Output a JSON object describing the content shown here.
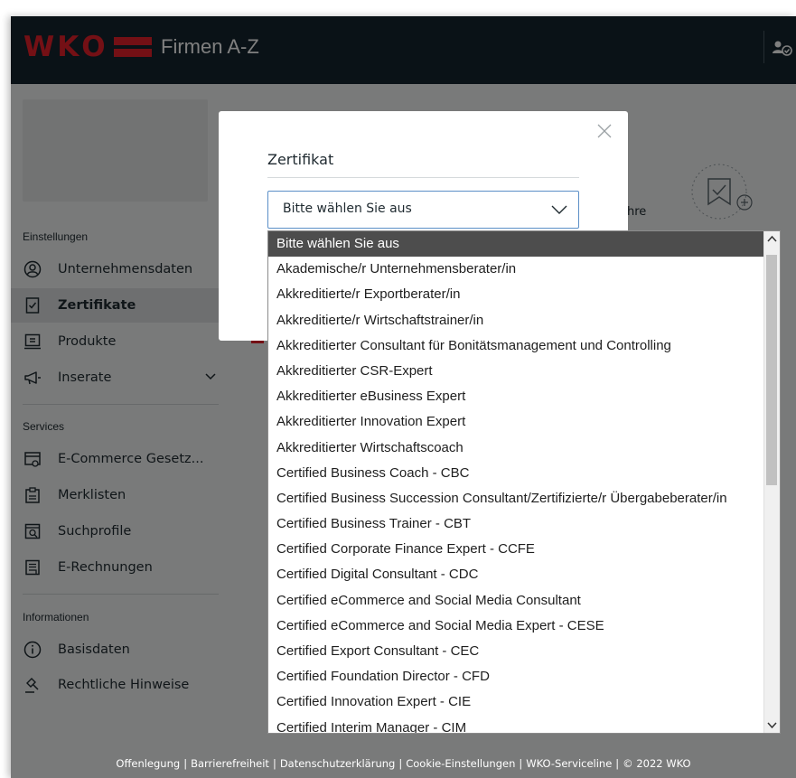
{
  "header": {
    "logo_letters": [
      "W",
      "K",
      "O"
    ],
    "app_title": "Firmen A-Z"
  },
  "sidebar": {
    "sections": [
      {
        "title": "Einstellungen",
        "items": [
          {
            "label": "Unternehmensdaten",
            "icon": "user-circle-icon"
          },
          {
            "label": "Zertifikate",
            "icon": "certificate-icon",
            "active": true
          },
          {
            "label": "Produkte",
            "icon": "product-icon"
          },
          {
            "label": "Inserate",
            "icon": "megaphone-icon",
            "has_chevron": true
          }
        ]
      },
      {
        "title": "Services",
        "items": [
          {
            "label": "E-Commerce Gesetz...",
            "icon": "ecommerce-icon"
          },
          {
            "label": "Merklisten",
            "icon": "clipboard-icon"
          },
          {
            "label": "Suchprofile",
            "icon": "search-profile-icon"
          },
          {
            "label": "E-Rechnungen",
            "icon": "invoice-icon"
          }
        ]
      },
      {
        "title": "Informationen",
        "items": [
          {
            "label": "Basisdaten",
            "icon": "info-icon"
          },
          {
            "label": "Rechtliche Hinweise",
            "icon": "gavel-icon"
          }
        ]
      }
    ]
  },
  "content": {
    "partial_text": "hre"
  },
  "modal": {
    "title": "Zertifikat",
    "select_value": "Bitte wählen Sie aus"
  },
  "dropdown": {
    "options": [
      "Bitte wählen Sie aus",
      "Akademische/r Unternehmensberater/in",
      "Akkreditierte/r Exportberater/in",
      "Akkreditierte/r Wirtschaftstrainer/in",
      "Akkreditierter Consultant für Bonitätsmanagement und Controlling",
      "Akkreditierter CSR-Expert",
      "Akkreditierter eBusiness Expert",
      "Akkreditierter Innovation Expert",
      "Akkreditierter Wirtschaftscoach",
      "Certified Business Coach - CBC",
      "Certified Business Succession Consultant/Zertifizierte/r Übergabeberater/in",
      "Certified Business Trainer - CBT",
      "Certified Corporate Finance Expert - CCFE",
      "Certified Digital Consultant - CDC",
      "Certified eCommerce and Social Media Consultant",
      "Certified eCommerce and Social Media Expert - CESE",
      "Certified Export Consultant - CEC",
      "Certified Foundation Director - CFD",
      "Certified Innovation Expert - CIE",
      "Certified Interim Manager - CIM"
    ],
    "selected_index": 0
  },
  "footer": {
    "links": [
      "Offenlegung",
      "Barrierefreiheit",
      "Datenschutzerklärung",
      "Cookie-Einstellungen",
      "WKO-Serviceline",
      "© 2022 WKO"
    ]
  },
  "colors": {
    "brand_red": "#e8202a",
    "header_bg": "#15252e",
    "selected_option_bg": "#4d4d4d",
    "select_border": "#5b8fc7"
  }
}
